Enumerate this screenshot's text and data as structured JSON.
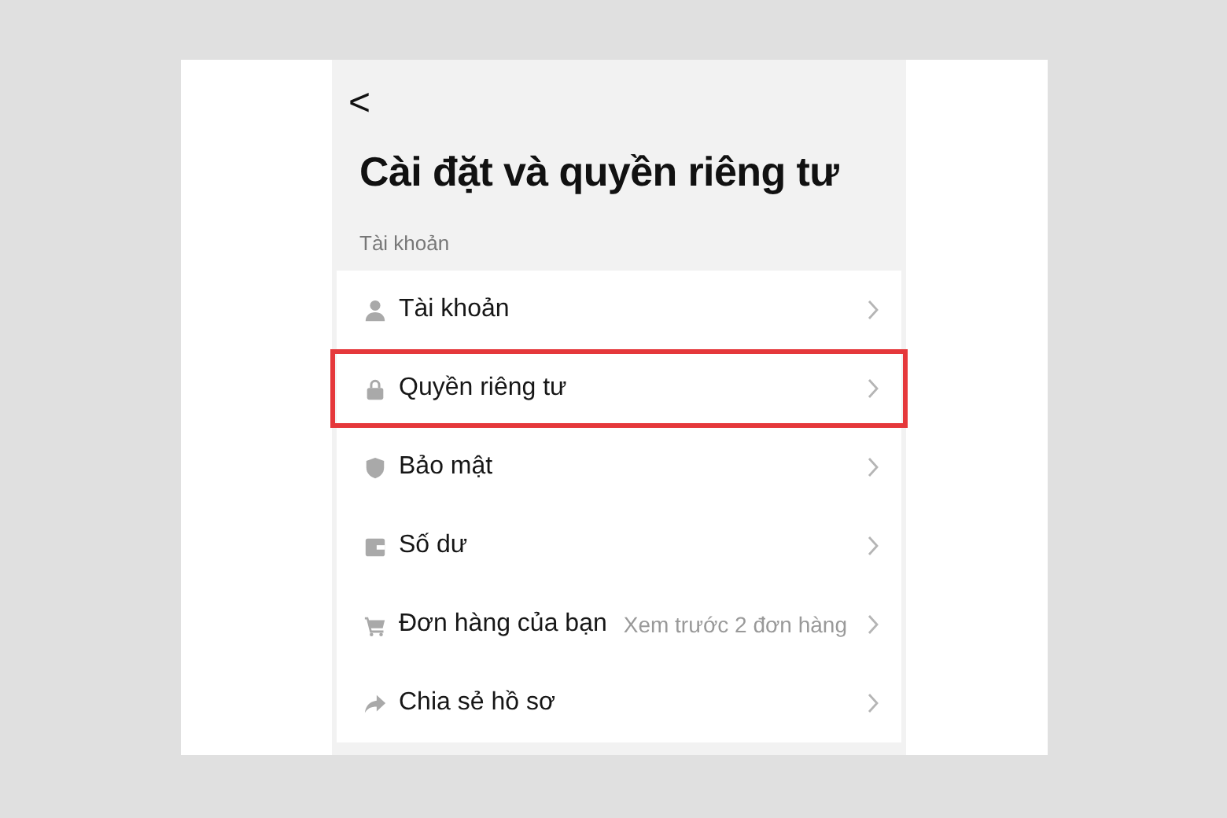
{
  "header": {
    "back": "<",
    "title": "Cài đặt và quyền riêng tư"
  },
  "section": {
    "label": "Tài khoản",
    "items": [
      {
        "kind": "person",
        "label": "Tài khoản",
        "highlighted": false
      },
      {
        "kind": "lock",
        "label": "Quyền riêng tư",
        "highlighted": true
      },
      {
        "kind": "shield",
        "label": "Bảo mật",
        "highlighted": false
      },
      {
        "kind": "wallet",
        "label": "Số dư",
        "highlighted": false
      },
      {
        "kind": "cart",
        "label": "Đơn hàng của bạn",
        "value": "Xem trước 2 đơn hàng",
        "highlighted": false
      },
      {
        "kind": "share",
        "label": "Chia sẻ hồ sơ",
        "highlighted": false
      }
    ]
  }
}
